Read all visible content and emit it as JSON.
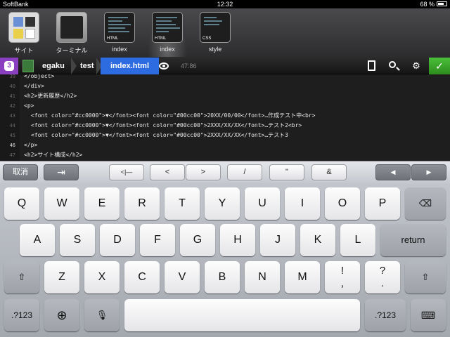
{
  "status_bar": {
    "carrier": "SoftBank",
    "time": "12:32",
    "battery": "68 %"
  },
  "files": [
    {
      "label": "サイト",
      "icon": "site-icon"
    },
    {
      "label": "ターミナル",
      "icon": "terminal-icon"
    },
    {
      "label": "index",
      "tag": "HTML",
      "icon": "html-file-icon"
    },
    {
      "label": "index",
      "tag": "HTML",
      "icon": "html-file-icon"
    },
    {
      "label": "style",
      "tag": "CSS",
      "icon": "css-file-icon"
    }
  ],
  "path_bar": {
    "tab_count": "3",
    "crumbs": [
      "egaku",
      "test",
      "index.html"
    ],
    "cursor_position": "47:86"
  },
  "editor": {
    "lines": [
      {
        "num": "39",
        "text": "</object>"
      },
      {
        "num": "40",
        "text": "</div>"
      },
      {
        "num": "41",
        "text": "<h2>更新履歴</h2>"
      },
      {
        "num": "42",
        "text": "<p>"
      },
      {
        "num": "43",
        "text": "<font color=\"#cc0000\">▼</font><font color=\"#00cc00\">20XX/00/00</font>…作成テスト中<br>"
      },
      {
        "num": "44",
        "text": "<font color=\"#cc0000\">▼</font><font color=\"#00cc00\">2XXX/XX/XX</font>…テスト2<br>"
      },
      {
        "num": "45",
        "text": "<font color=\"#cc0000\">▼</font><font color=\"#00cc00\">2XXX/XX/XX</font>…テスト3"
      },
      {
        "num": "46",
        "text": "</p>"
      },
      {
        "num": "47",
        "text": "<h2>サイト構成</h2>"
      }
    ]
  },
  "accessory": {
    "cancel": "取消",
    "tab": "⇥",
    "hide": "<|—",
    "lt": "<",
    "gt": ">",
    "slash": "/",
    "quote": "\"",
    "amp": "&",
    "left": "◀",
    "right": "▶"
  },
  "keys": {
    "row1": [
      "Q",
      "W",
      "E",
      "R",
      "T",
      "Y",
      "U",
      "I",
      "O",
      "P"
    ],
    "row2": [
      "A",
      "S",
      "D",
      "F",
      "G",
      "H",
      "J",
      "K",
      "L"
    ],
    "row3": [
      "Z",
      "X",
      "C",
      "V",
      "B",
      "N",
      "M"
    ],
    "excl": "!",
    "excl_sub": ",",
    "quest": "?",
    "quest_sub": ".",
    "return": "return",
    "num": ".?123",
    "num2": ".?123"
  },
  "colors": {
    "accent_blue": "#2d6ce0",
    "badge_purple": "#8a3fc0",
    "check_green": "#3aae2a"
  }
}
